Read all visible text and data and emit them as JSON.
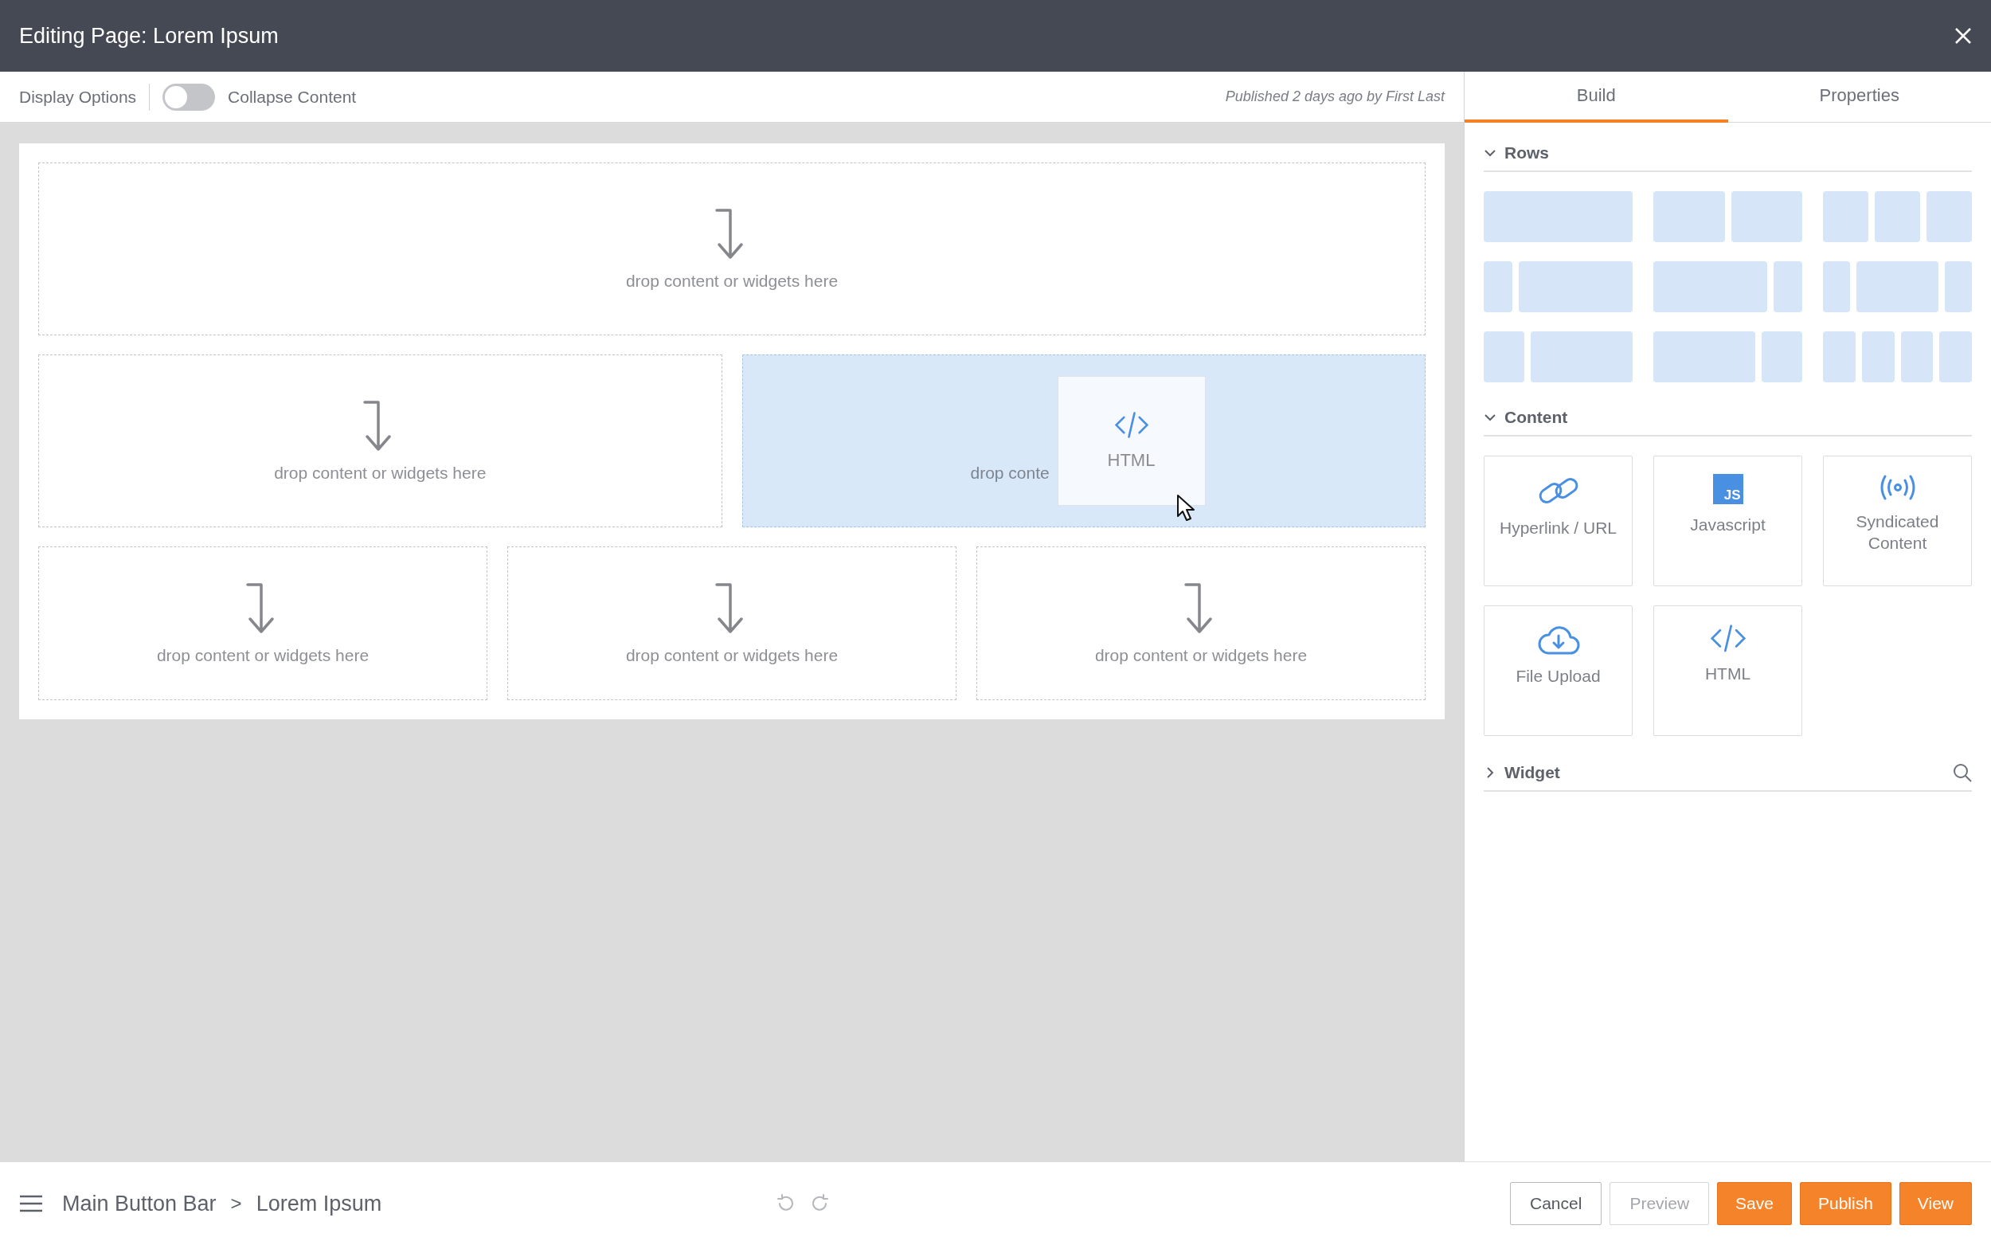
{
  "window": {
    "title": "Editing Page: Lorem Ipsum"
  },
  "toolbar": {
    "display_options": "Display Options",
    "collapse_toggle": {
      "label": "Collapse Content",
      "on": false
    },
    "status": "Published 2 days ago by First Last"
  },
  "canvas": {
    "rows": [
      {
        "zones": [
          {
            "text": "drop content or widgets here",
            "highlighted": false
          }
        ]
      },
      {
        "zones": [
          {
            "text": "drop content or widgets here",
            "highlighted": false
          },
          {
            "text": "drop conte",
            "highlighted": true
          }
        ]
      },
      {
        "zones": [
          {
            "text": "drop content or widgets here",
            "highlighted": false
          },
          {
            "text": "drop content or widgets here",
            "highlighted": false
          },
          {
            "text": "drop content or widgets here",
            "highlighted": false
          }
        ]
      }
    ],
    "dragged_item": {
      "kind": "code",
      "label": "HTML"
    }
  },
  "panel": {
    "tabs": [
      {
        "label": "Build",
        "selected": true
      },
      {
        "label": "Properties",
        "selected": false
      }
    ],
    "sections": [
      {
        "title": "Rows",
        "expanded": true,
        "kind": "layouts"
      },
      {
        "title": "Content",
        "expanded": true,
        "kind": "items",
        "items": [
          {
            "kind": "link",
            "label": "Hyperlink / URL"
          },
          {
            "kind": "js",
            "label": "Javascript",
            "icon_text": "JS"
          },
          {
            "kind": "broadcast",
            "label": "Syndicated Content"
          },
          {
            "kind": "cloud",
            "label": "File Upload"
          },
          {
            "kind": "code",
            "label": "HTML"
          }
        ]
      },
      {
        "title": "Widget",
        "expanded": false,
        "kind": "search"
      }
    ]
  },
  "bottom_bar": {
    "breadcrumb": [
      "Main Button Bar",
      "Lorem Ipsum"
    ],
    "separator": ">",
    "undo_disabled": true,
    "redo_disabled": true,
    "buttons": [
      {
        "label": "Cancel",
        "kind": "outline",
        "disabled": false
      },
      {
        "label": "Preview",
        "kind": "outline",
        "disabled": true
      },
      {
        "label": "Save",
        "kind": "primary",
        "disabled": false
      },
      {
        "label": "Publish",
        "kind": "primary",
        "disabled": false
      },
      {
        "label": "View",
        "kind": "primary",
        "disabled": false
      }
    ]
  }
}
